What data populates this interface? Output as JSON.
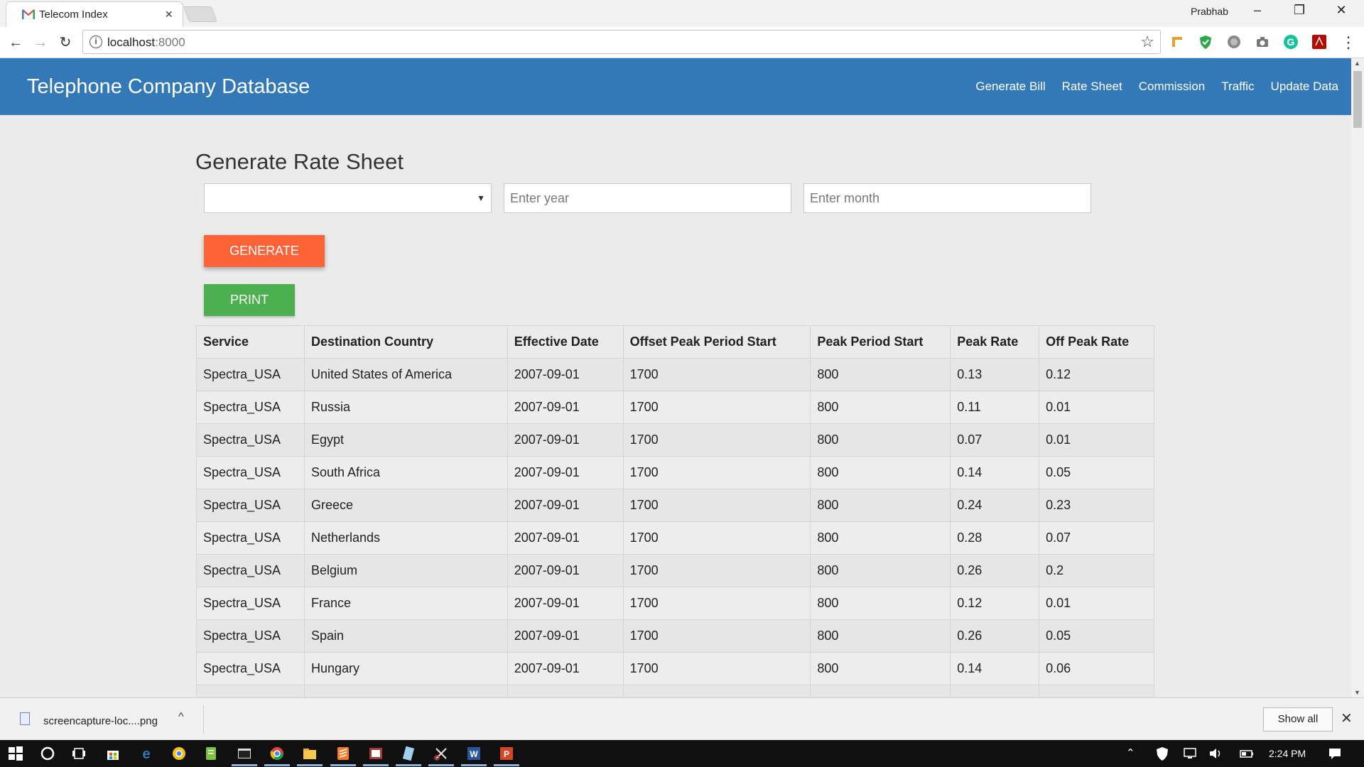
{
  "browser": {
    "tab_title": "Telecom Index",
    "tab_close": "×",
    "profile_name": "Prabhab",
    "minimize": "–",
    "restore": "❐",
    "close": "✕",
    "back": "←",
    "forward": "→",
    "reload": "↻",
    "url_host": "localhost",
    "url_port": ":8000",
    "bookmark_star": "☆"
  },
  "navbar": {
    "brand": "Telephone Company Database",
    "links": [
      "Generate Bill",
      "Rate Sheet",
      "Commission",
      "Traffic",
      "Update Data"
    ],
    "color": "#3378b7"
  },
  "form": {
    "heading": "Generate Rate Sheet",
    "select_value": "",
    "year_placeholder": "Enter year",
    "month_placeholder": "Enter month",
    "generate_label": "GENERATE",
    "print_label": "PRINT",
    "generate_color": "#fd6337",
    "print_color": "#4caf50"
  },
  "table": {
    "headers": [
      "Service",
      "Destination Country",
      "Effective Date",
      "Offset Peak Period Start",
      "Peak Period Start",
      "Peak Rate",
      "Off Peak Rate"
    ],
    "rows": [
      [
        "Spectra_USA",
        "United States of America",
        "2007-09-01",
        "1700",
        "800",
        "0.13",
        "0.12"
      ],
      [
        "Spectra_USA",
        "Russia",
        "2007-09-01",
        "1700",
        "800",
        "0.11",
        "0.01"
      ],
      [
        "Spectra_USA",
        "Egypt",
        "2007-09-01",
        "1700",
        "800",
        "0.07",
        "0.01"
      ],
      [
        "Spectra_USA",
        "South Africa",
        "2007-09-01",
        "1700",
        "800",
        "0.14",
        "0.05"
      ],
      [
        "Spectra_USA",
        "Greece",
        "2007-09-01",
        "1700",
        "800",
        "0.24",
        "0.23"
      ],
      [
        "Spectra_USA",
        "Netherlands",
        "2007-09-01",
        "1700",
        "800",
        "0.28",
        "0.07"
      ],
      [
        "Spectra_USA",
        "Belgium",
        "2007-09-01",
        "1700",
        "800",
        "0.26",
        "0.2"
      ],
      [
        "Spectra_USA",
        "France",
        "2007-09-01",
        "1700",
        "800",
        "0.12",
        "0.01"
      ],
      [
        "Spectra_USA",
        "Spain",
        "2007-09-01",
        "1700",
        "800",
        "0.26",
        "0.05"
      ],
      [
        "Spectra_USA",
        "Hungary",
        "2007-09-01",
        "1700",
        "800",
        "0.14",
        "0.06"
      ],
      [
        "",
        "",
        "",
        "",
        "",
        "",
        ""
      ]
    ]
  },
  "download_bar": {
    "file_name": "screencapture-loc....png",
    "chevron": "^",
    "show_all": "Show all",
    "close": "✕"
  },
  "taskbar": {
    "clock": "2:24 PM",
    "icons": [
      "windows-start-icon",
      "cortana-icon",
      "task-view-icon",
      "store-icon",
      "edge-icon",
      "chrome-canary-icon",
      "notepad-plus-icon",
      "terminal-icon",
      "chrome-icon",
      "file-explorer-icon",
      "sublime-text-icon",
      "ms-access-icon",
      "notepad-icon",
      "snipping-tool-icon",
      "word-icon",
      "powerpoint-icon"
    ]
  }
}
